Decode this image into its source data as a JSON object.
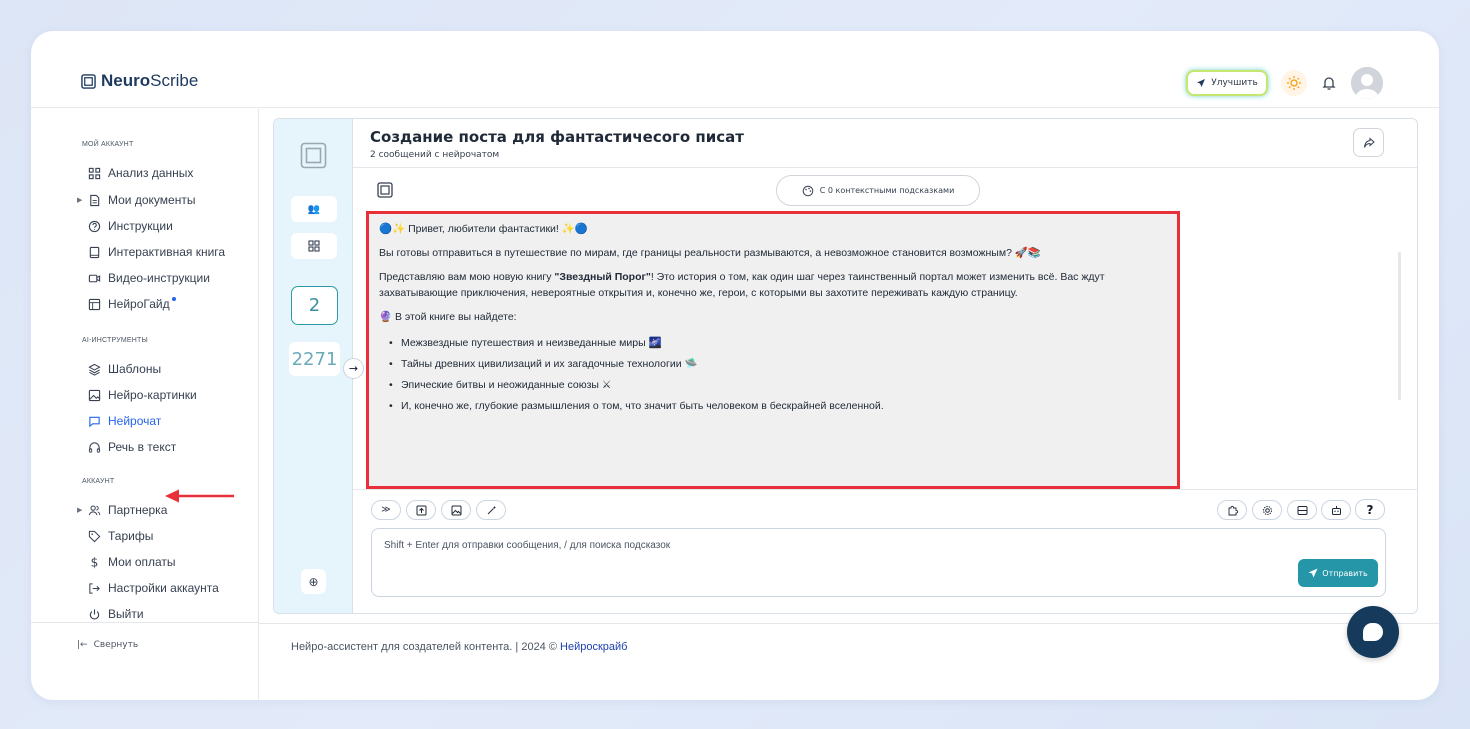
{
  "brand": {
    "name_bold": "Neuro",
    "name_regular": "Scribe"
  },
  "header": {
    "upgrade_label": "Улучшить"
  },
  "sidebar": {
    "section_account": "МОЙ АККАУНТ",
    "account_items": [
      {
        "label": "Анализ данных"
      },
      {
        "label": "Мои документы"
      },
      {
        "label": "Инструкции"
      },
      {
        "label": "Интерактивная книга"
      },
      {
        "label": "Видео-инструкции"
      },
      {
        "label": "НейроГайд"
      }
    ],
    "section_ai": "AI-ИНСТРУМЕНТЫ",
    "ai_items": [
      {
        "label": "Шаблоны"
      },
      {
        "label": "Нейро-картинки"
      },
      {
        "label": "Нейрочат"
      },
      {
        "label": "Речь в текст"
      }
    ],
    "section_acc2": "АККАУНТ",
    "acc_items": [
      {
        "label": "Партнерка"
      },
      {
        "label": "Тарифы"
      },
      {
        "label": "Мои оплаты"
      },
      {
        "label": "Настройки аккаунта"
      },
      {
        "label": "Выйти"
      }
    ],
    "collapse_label": "Свернуть"
  },
  "chat": {
    "title": "Создание поста для фантастичесого писат",
    "subtitle": "2 сообщений с нейрочатом",
    "hints_label": "С 0 контекстными подсказками",
    "counter_box": "2",
    "counter_plain": "2271",
    "message": {
      "greeting": "🔵✨ Привет, любители фантастики! ✨🔵",
      "p1": "Вы готовы отправиться в путешествие по мирам, где границы реальности размываются, а невозможное становится возможным? 🚀📚",
      "p2_before": "Представляю вам мою новую книгу ",
      "p2_bold": "\"Звездный Порог\"",
      "p2_after": "! Это история о том, как один шаг через таинственный портал может изменить всё. Вас ждут захватывающие приключения, невероятные открытия и, конечно же, герои, с которыми вы захотите переживать каждую страницу.",
      "list_intro": "🔮 В этой книге вы найдете:",
      "list": [
        "Межзвездные путешествия и неизведанные миры 🌌",
        "Тайны древних цивилизаций и их загадочные технологии 🛸",
        "Эпические битвы и неожиданные союзы ⚔",
        "И, конечно же, глубокие размышления о том, что значит быть человеком в бескрайней вселенной."
      ]
    },
    "input_placeholder": "Shift + Enter для отправки сообщения, / для поиска подсказок",
    "send_label": "Отправить",
    "help_label": "?"
  },
  "footer": {
    "text": "Нейро-ассистент для создателей контента.  | 2024 © ",
    "link": "Нейроскрайб"
  },
  "colors": {
    "accent": "#2596a8",
    "highlight_border": "#e8303a",
    "fab": "#153a5b",
    "link": "#2563eb"
  }
}
